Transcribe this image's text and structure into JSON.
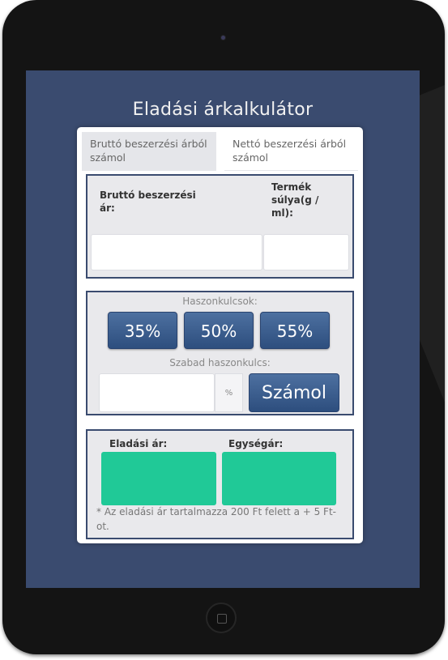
{
  "app": {
    "title": "Eladási árkalkulátor"
  },
  "tabs": [
    {
      "label": "Bruttó beszerzési árból számol"
    },
    {
      "label": "Nettó beszerzési árból számol"
    }
  ],
  "inputs": {
    "gross_price_label": "Bruttó beszerzési ár:",
    "weight_label": "Termék súlya(g / ml):",
    "gross_price_value": "",
    "weight_value": ""
  },
  "margins": {
    "heading": "Haszonkulcsok:",
    "buttons": [
      "35%",
      "50%",
      "55%"
    ],
    "custom_label": "Szabad haszonkulcs:",
    "custom_value": "",
    "percent_addon": "%",
    "calc_button": "Számol"
  },
  "results": {
    "sale_price_label": "Eladási ár:",
    "unit_price_label": "Egységár:",
    "sale_price_value": "",
    "unit_price_value": "",
    "note": "* Az eladási ár tartalmazza 200 Ft felett a + 5 Ft-ot."
  },
  "colors": {
    "screen_bg": "#3a4b6f",
    "button": "#3b5d8f",
    "result": "#20c997"
  }
}
